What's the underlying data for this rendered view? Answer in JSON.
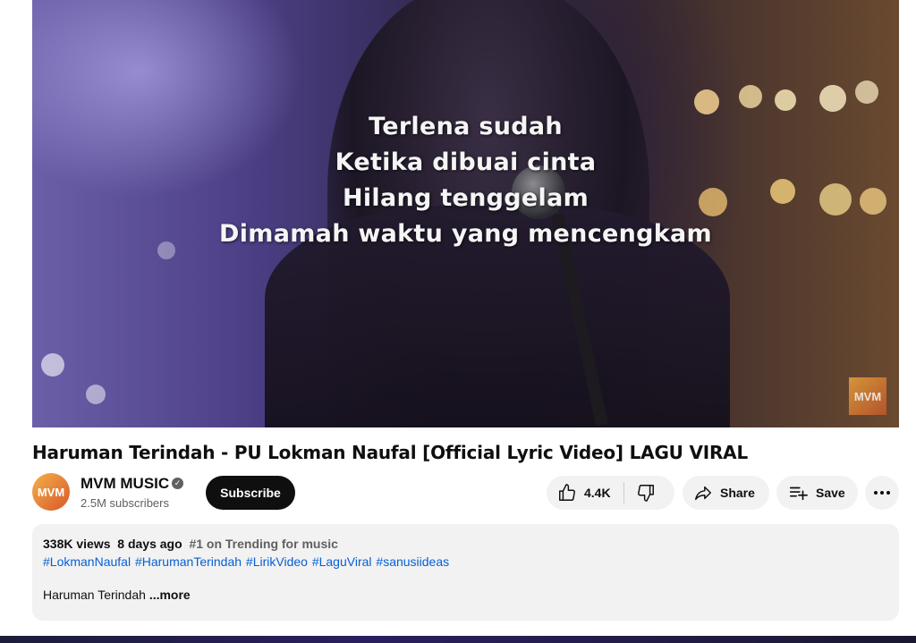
{
  "player": {
    "lyrics": [
      "Terlena sudah",
      "Ketika dibuai cinta",
      "Hilang tenggelam",
      "Dimamah waktu yang mencengkam"
    ],
    "watermark": "MVM"
  },
  "video": {
    "title": "Haruman Terindah - PU Lokman Naufal [Official Lyric Video] LAGU VIRAL"
  },
  "channel": {
    "avatar_text": "MVM",
    "name": "MVM MUSIC",
    "verified_icon": "verified-check-icon",
    "subscribers": "2.5M subscribers",
    "subscribe_label": "Subscribe"
  },
  "actions": {
    "like_count": "4.4K",
    "share_label": "Share",
    "save_label": "Save"
  },
  "description": {
    "views": "338K views",
    "date": "8 days ago",
    "trending": "#1 on Trending for music",
    "hashtags": [
      "#LokmanNaufal",
      "#HarumanTerindah",
      "#LirikVideo",
      "#LaguViral",
      "#sanusiideas"
    ],
    "text": "Haruman Terindah",
    "more_label": "...more"
  },
  "colors": {
    "subscribe_bg": "#0f0f0f",
    "pill_bg": "#f2f2f2",
    "hashtag": "#065fd4"
  }
}
